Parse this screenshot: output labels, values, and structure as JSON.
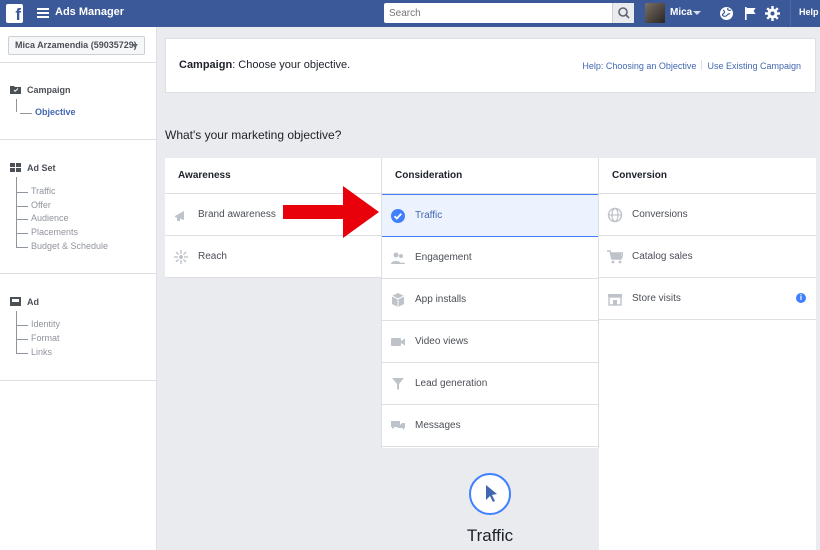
{
  "topbar": {
    "logo": "f",
    "app_title": "Ads Manager",
    "search_placeholder": "Search",
    "user_name": "Mica",
    "help_label": "Help",
    "bg_color": "#3b5998"
  },
  "sidebar": {
    "account": "Mica Arzamendia (59035729)",
    "sections": [
      {
        "title": "Campaign",
        "icon": "folder-icon",
        "items": [
          "Objective"
        ],
        "active_item": "Objective"
      },
      {
        "title": "Ad Set",
        "icon": "grid-icon",
        "items": [
          "Traffic",
          "Offer",
          "Audience",
          "Placements",
          "Budget & Schedule"
        ]
      },
      {
        "title": "Ad",
        "icon": "ad-icon",
        "items": [
          "Identity",
          "Format",
          "Links"
        ]
      }
    ]
  },
  "header": {
    "campaign_bold": "Campaign",
    "campaign_rest": ": Choose your objective.",
    "help_link": "Help: Choosing an Objective",
    "existing_link": "Use Existing Campaign"
  },
  "question": "What's your marketing objective?",
  "columns": [
    {
      "title": "Awareness",
      "items": [
        {
          "label": "Brand awareness",
          "icon": "megaphone-icon"
        },
        {
          "label": "Reach",
          "icon": "reach-icon"
        }
      ]
    },
    {
      "title": "Consideration",
      "items": [
        {
          "label": "Traffic",
          "icon": "check-circle-icon",
          "selected": true
        },
        {
          "label": "Engagement",
          "icon": "people-icon"
        },
        {
          "label": "App installs",
          "icon": "box-icon"
        },
        {
          "label": "Video views",
          "icon": "video-icon"
        },
        {
          "label": "Lead generation",
          "icon": "funnel-icon"
        },
        {
          "label": "Messages",
          "icon": "chat-icon"
        }
      ]
    },
    {
      "title": "Conversion",
      "items": [
        {
          "label": "Conversions",
          "icon": "globe-icon"
        },
        {
          "label": "Catalog sales",
          "icon": "cart-icon"
        },
        {
          "label": "Store visits",
          "icon": "store-icon"
        }
      ]
    }
  ],
  "preview": {
    "title": "Traffic",
    "icon": "cursor-icon"
  },
  "colors": {
    "accent": "#4080ff",
    "selected_bg": "#ecf3ff",
    "arrow": "#e8000b"
  }
}
